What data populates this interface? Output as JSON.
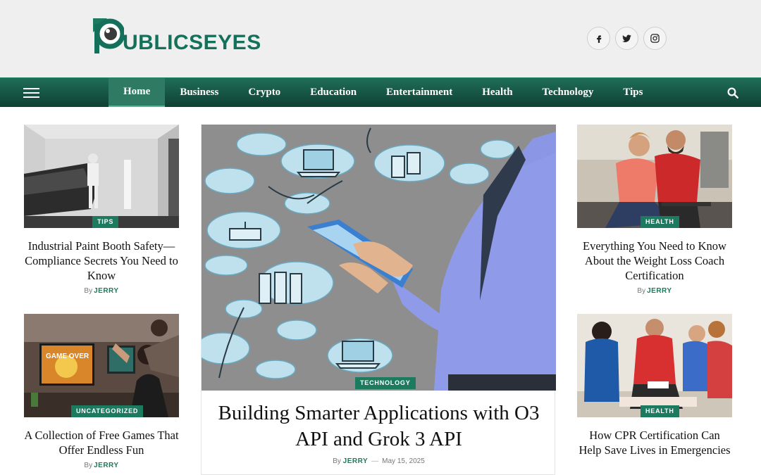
{
  "brand": {
    "logo_text": "UBLICSEYES"
  },
  "socials": [
    {
      "icon": "facebook-icon",
      "glyph": "f"
    },
    {
      "icon": "twitter-icon",
      "glyph": "t"
    },
    {
      "icon": "instagram-icon",
      "glyph": "ig"
    }
  ],
  "nav": {
    "items": [
      "Home",
      "Business",
      "Crypto",
      "Education",
      "Entertainment",
      "Health",
      "Technology",
      "Tips"
    ],
    "active": "Home"
  },
  "colors": {
    "brand": "#1c7a5f",
    "nav_top": "#1f6e57",
    "nav_bottom": "#0f3f33"
  },
  "cards": {
    "left_top": {
      "category": "TIPS",
      "title": "Industrial Paint Booth Safety—Compliance Secrets You Need to Know",
      "by": "By",
      "author": "JERRY"
    },
    "left_bottom": {
      "category": "UNCATEGORIZED",
      "title": "A Collection of Free Games That Offer Endless Fun",
      "by": "By",
      "author": "JERRY"
    },
    "right_top": {
      "category": "HEALTH",
      "title": "Everything You Need to Know About the Weight Loss Coach Certification",
      "by": "By",
      "author": "JERRY"
    },
    "right_bottom": {
      "category": "HEALTH",
      "title": "How CPR Certification Can Help Save Lives in Emergencies",
      "by": "By",
      "author": "JERRY"
    }
  },
  "feature": {
    "category": "TECHNOLOGY",
    "title": "Building Smarter Applications with O3 API and Grok 3 API",
    "by": "By",
    "author": "JERRY",
    "separator": "—",
    "date": "May 15, 2025",
    "game_screen_text": "GAME OVER"
  }
}
